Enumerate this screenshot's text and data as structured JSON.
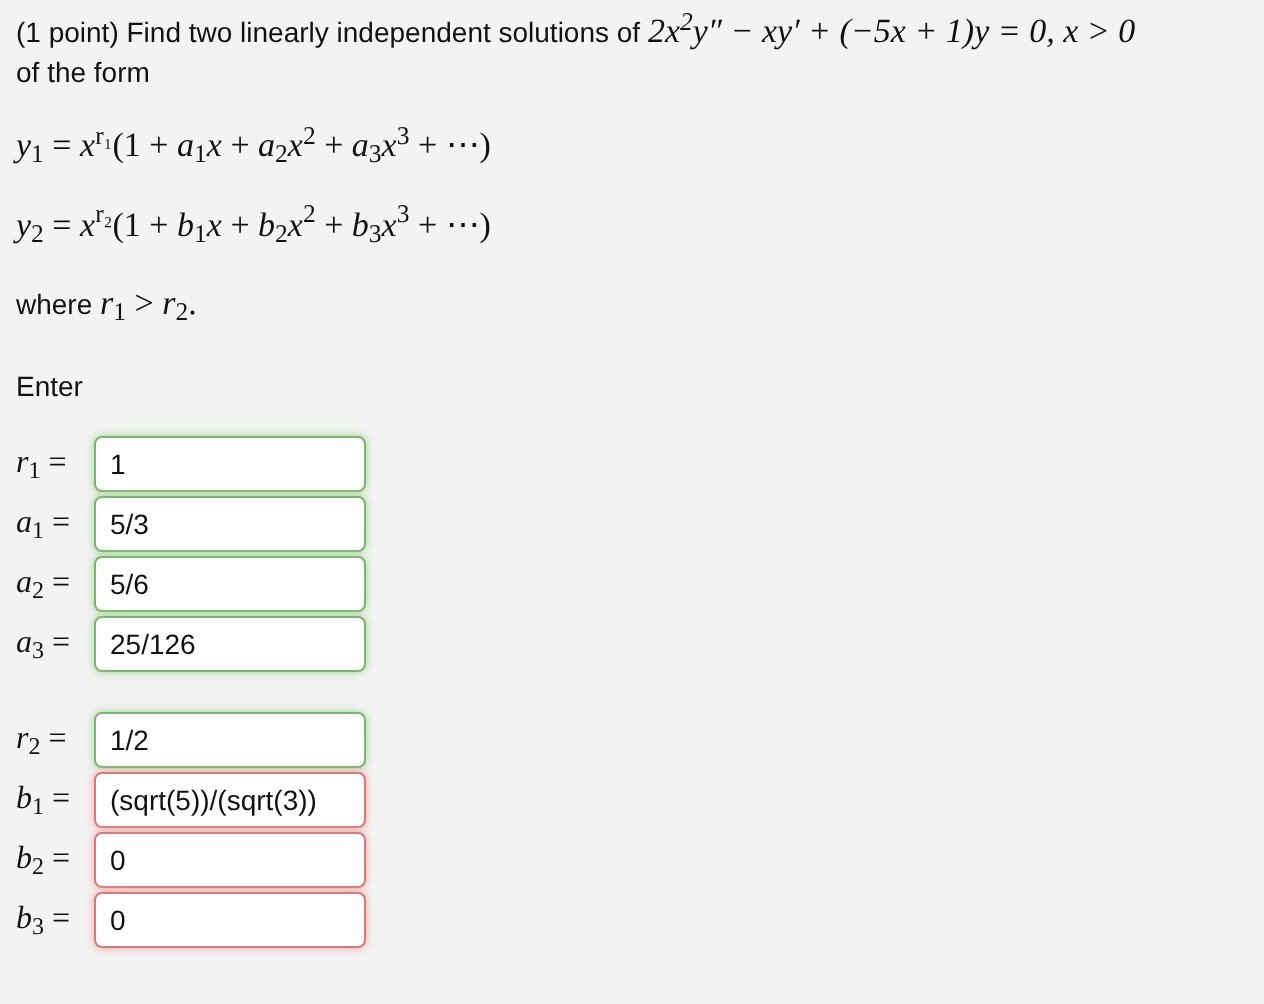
{
  "problem": {
    "text": "(1 point) Find two linearly independent solutions of",
    "equation": "2x$^{2}$y″ − xy′ + (−5x + 1)y = 0,  x > 0",
    "suffix": "of the form"
  },
  "series": [
    "*y*$_{1}$ = *x*$^{r₁}$(1 + *a*$_{1}$*x* + *a*$_{2}$*x*$^{2}$ + *a*$_{3}$*x*$^{3}$ + ⋯)",
    "*y*$_{2}$ = *x*$^{r₂}$(1 + *b*$_{1}$*x* + *b*$_{2}$*x*$^{2}$ + *b*$_{3}$*x*$^{3}$ + ⋯)"
  ],
  "condition": {
    "text": "where",
    "equation": "*r*$_{1}$ > *r*$_{2}$."
  },
  "enter_label": "Enter",
  "answer_groups": [
    [
      {
        "label": "*r*$_{1}$ =",
        "value": "1",
        "correct": true
      },
      {
        "label": "*a*$_{1}$ =",
        "value": "5/3",
        "correct": true
      },
      {
        "label": "*a*$_{2}$ =",
        "value": "5/6",
        "correct": true
      },
      {
        "label": "*a*$_{3}$ =",
        "value": "25/126",
        "correct": true
      }
    ],
    [
      {
        "label": "*r*$_{2}$ =",
        "value": "1/2",
        "correct": true
      },
      {
        "label": "*b*$_{1}$ =",
        "value": "(sqrt(5))/(sqrt(3))",
        "correct": false
      },
      {
        "label": "*b*$_{2}$ =",
        "value": "0",
        "correct": false
      },
      {
        "label": "*b*$_{3}$ =",
        "value": "0",
        "correct": false
      }
    ]
  ]
}
